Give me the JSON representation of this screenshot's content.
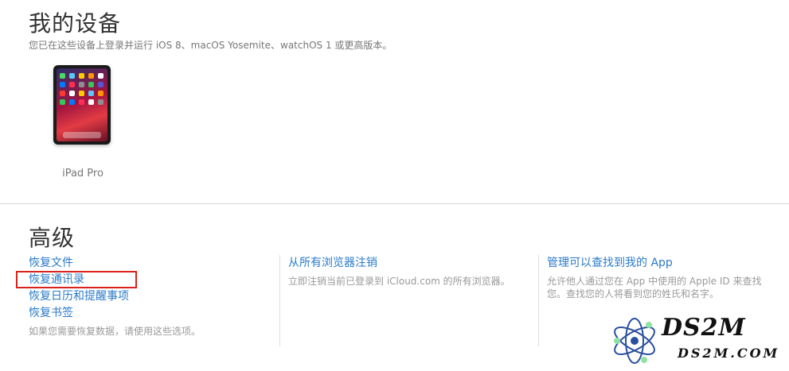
{
  "devices_section": {
    "title": "我的设备",
    "subtitle": "您已在这些设备上登录并运行 iOS 8、macOS Yosemite、watchOS 1 或更高版本。",
    "devices": [
      {
        "name": "iPad Pro",
        "icon": "ipad-icon"
      }
    ]
  },
  "advanced_section": {
    "title": "高级",
    "restore": {
      "links": [
        "恢复文件",
        "恢复通讯录",
        "恢复日历和提醒事项",
        "恢复书签"
      ],
      "note": "如果您需要恢复数据，请使用这些选项。",
      "highlighted_index": 1,
      "highlight_color": "#d9221b"
    },
    "browsers": {
      "link": "从所有浏览器注销",
      "description": "立即注销当前已登录到 iCloud.com 的所有浏览器。"
    },
    "find_my": {
      "link": "管理可以查找到我的 App",
      "description": "允许他人通过您在 App 中使用的 Apple ID 来查找您。查找您的人将看到您的姓氏和名字。"
    }
  },
  "watermark": {
    "brand": "DS2M",
    "sub": "DS2M.COM"
  },
  "colors": {
    "link": "#2a7ac9",
    "heading": "#333333",
    "muted": "#999999"
  }
}
